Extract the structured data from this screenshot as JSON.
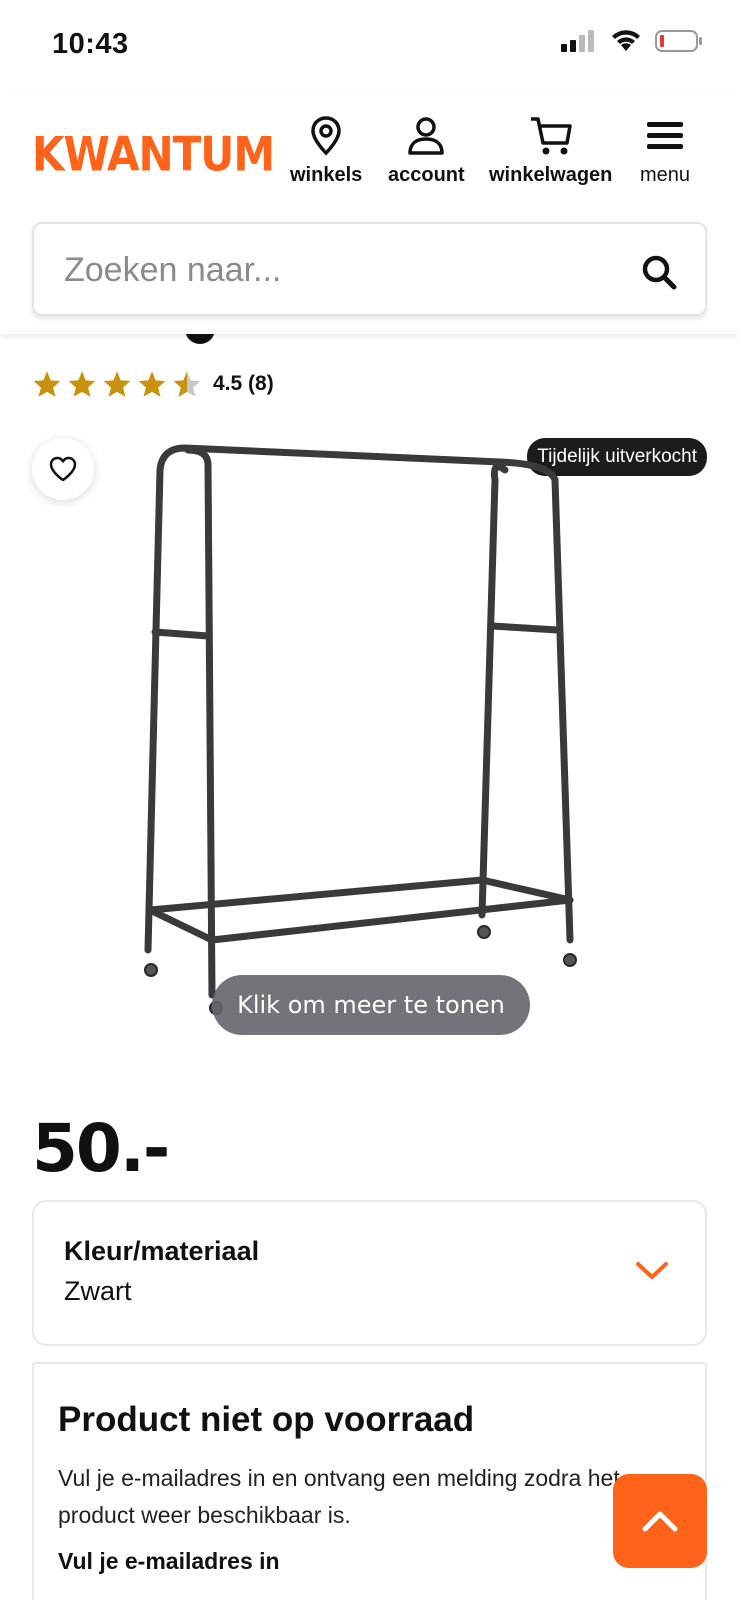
{
  "status_bar": {
    "time": "10:43"
  },
  "header": {
    "logo": "KWANTUM",
    "nav": [
      {
        "label": "winkels",
        "icon": "location-pin-icon"
      },
      {
        "label": "account",
        "icon": "user-icon"
      },
      {
        "label": "winkelwagen",
        "icon": "cart-icon"
      },
      {
        "label": "menu",
        "icon": "hamburger-icon"
      }
    ]
  },
  "search": {
    "placeholder": "Zoeken naar..."
  },
  "product": {
    "rating": {
      "value": 4.5,
      "text": "4.5 (8)"
    },
    "badge": "Tijdelijk uitverkocht",
    "image_button": "Klik om meer te tonen",
    "price": "50.-",
    "variant": {
      "title": "Kleur/materiaal",
      "value": "Zwart"
    }
  },
  "stock_notice": {
    "title": "Product niet op voorraad",
    "description": "Vul je e-mailadres in en ontvang een melding zodra het product weer beschikbaar is.",
    "email_label": "Vul je e-mailadres in"
  },
  "colors": {
    "brand": "#ff6319",
    "star": "#c9920e",
    "dark": "#1c1c1c"
  }
}
